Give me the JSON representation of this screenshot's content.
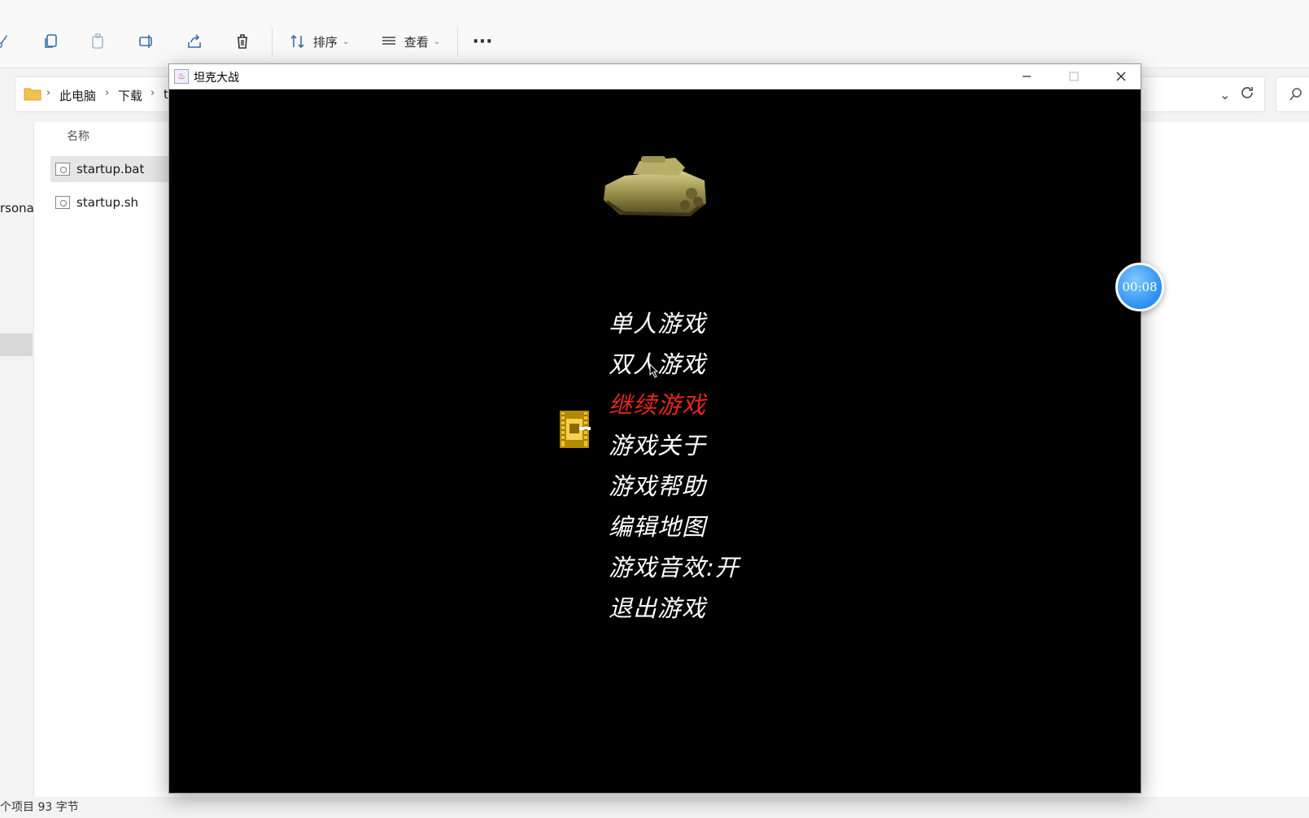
{
  "explorer": {
    "toolbar": {
      "sort_label": "排序",
      "view_label": "查看",
      "more_label": "···"
    },
    "breadcrumb": [
      "此电脑",
      "下载",
      "t"
    ],
    "column_header": "名称",
    "nav_fragment": "rsona",
    "files": [
      {
        "name": "startup.bat",
        "selected": true
      },
      {
        "name": "startup.sh",
        "selected": false
      }
    ],
    "status": "个项目  93 字节"
  },
  "game_window": {
    "title": "坦克大战",
    "menu": [
      {
        "label": "单人游戏",
        "active": false
      },
      {
        "label": "双人游戏",
        "active": false
      },
      {
        "label": "继续游戏",
        "active": true
      },
      {
        "label": "游戏关于",
        "active": false
      },
      {
        "label": "游戏帮助",
        "active": false
      },
      {
        "label": "编辑地图",
        "active": false
      },
      {
        "label": "游戏音效:开",
        "active": false
      },
      {
        "label": "退出游戏",
        "active": false
      }
    ],
    "colors": {
      "menu_text": "#ffffff",
      "menu_active": "#e8261e",
      "background": "#000000"
    }
  },
  "recorder": {
    "timer": "00:08"
  }
}
